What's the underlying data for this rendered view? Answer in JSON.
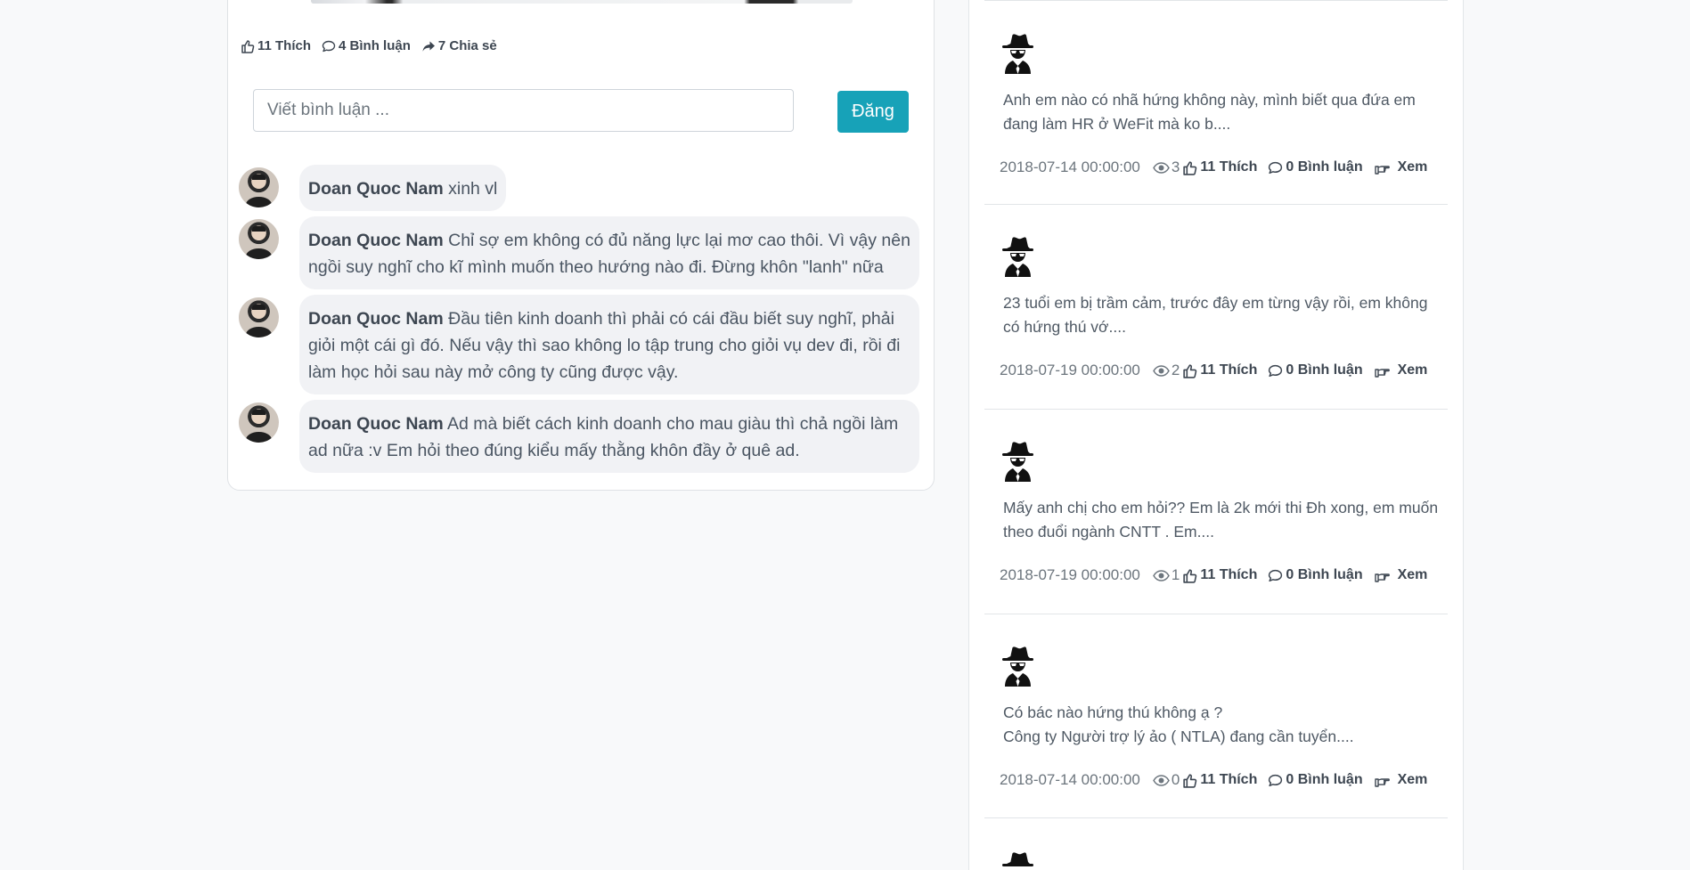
{
  "post": {
    "likes": "11 Thích",
    "comments": "4 Bình luận",
    "shares": "7 Chia sẻ",
    "comment_placeholder": "Viết bình luận ...",
    "post_button": "Đăng"
  },
  "comments": [
    {
      "name": "Doan Quoc Nam",
      "text": "xinh vl"
    },
    {
      "name": "Doan Quoc Nam",
      "text": "Chỉ sợ em không có đủ năng lực lại mơ cao thôi. Vì vậy nên ngồi suy nghĩ cho kĩ mình muốn theo hướng nào đi. Đừng khôn \"lanh\" nữa"
    },
    {
      "name": "Doan Quoc Nam",
      "text": "Đầu tiên kinh doanh thì phải có cái đầu biết suy nghĩ, phải giỏi một cái gì đó. Nếu vậy thì sao không lo tập trung cho giỏi vụ dev đi, rồi đi làm học hỏi sau này mở công ty cũng được vậy."
    },
    {
      "name": "Doan Quoc Nam",
      "text": "Ad mà biết cách kinh doanh cho mau giàu thì chả ngồi làm ad nữa :v Em hỏi theo đúng kiểu mấy thằng khôn đầy ở quê ad."
    }
  ],
  "sidebar": {
    "questions": [
      {
        "text": "Anh em nào có nhã hứng không này, mình biết qua đứa em\nđang làm HR ở WeFit mà ko b....",
        "date": "2018-07-14 00:00:00",
        "views": "3",
        "likes": "11 Thích",
        "comments": "0 Bình luận",
        "view_label": "Xem"
      },
      {
        "text": "23 tuổi em bị trầm cảm, trước đây em từng vậy rồi, em không\ncó hứng thú vớ....",
        "date": "2018-07-19 00:00:00",
        "views": "2",
        "likes": "11 Thích",
        "comments": "0 Bình luận",
        "view_label": "Xem"
      },
      {
        "text": "Mấy anh chị cho em hỏi?? Em là 2k mới thi Đh xong, em muốn\ntheo đuổi ngành CNTT . Em....",
        "date": "2018-07-19 00:00:00",
        "views": "1",
        "likes": "11 Thích",
        "comments": "0 Bình luận",
        "view_label": "Xem"
      },
      {
        "text": "Có bác nào hứng thú không ạ ?\nCông ty Người trợ lý ảo ( NTLA) đang cần tuyển....",
        "date": "2018-07-14 00:00:00",
        "views": "0",
        "likes": "11 Thích",
        "comments": "0 Bình luận",
        "view_label": "Xem"
      }
    ]
  },
  "icons": {
    "like": "thumbs-up-icon",
    "comment": "speech-bubble-icon",
    "share": "share-arrow-icon",
    "view": "eye-icon",
    "see": "hand-pointer-icon",
    "anonymous": "spy-icon"
  },
  "colors": {
    "accent": "#17a2b8",
    "background": "#f8f9fa"
  }
}
